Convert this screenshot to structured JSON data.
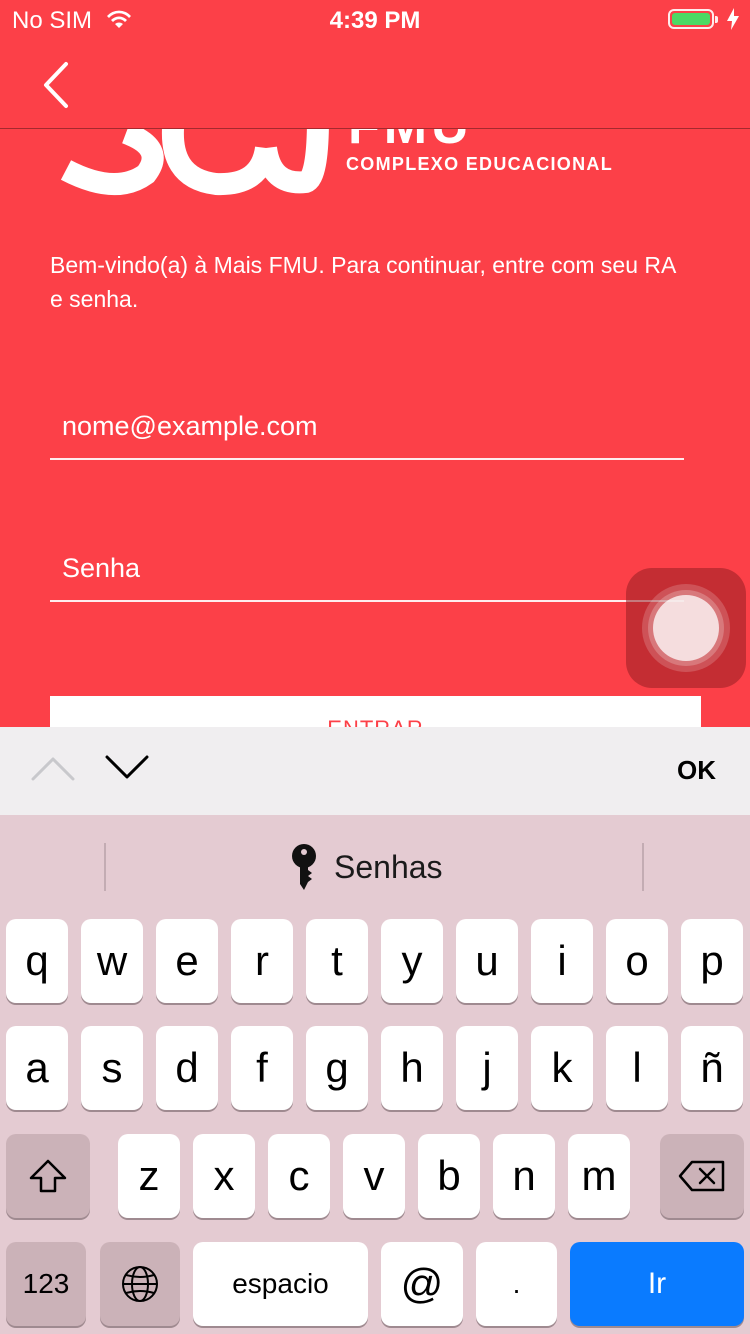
{
  "status_bar": {
    "carrier": "No SIM",
    "time": "4:39 PM"
  },
  "logo": {
    "brand": "FMU",
    "subtitle": "COMPLEXO EDUCACIONAL"
  },
  "welcome_text": "Bem-vindo(a) à Mais FMU. Para continuar, entre com seu RA e senha.",
  "form": {
    "email_placeholder": "nome@example.com",
    "password_placeholder": "Senha",
    "submit_label": "ENTRAR"
  },
  "accessory": {
    "done_label": "OK"
  },
  "keyboard": {
    "suggestion": "Senhas",
    "row1": [
      "q",
      "w",
      "e",
      "r",
      "t",
      "y",
      "u",
      "i",
      "o",
      "p"
    ],
    "row2": [
      "a",
      "s",
      "d",
      "f",
      "g",
      "h",
      "j",
      "k",
      "l",
      "ñ"
    ],
    "row3": [
      "z",
      "x",
      "c",
      "v",
      "b",
      "n",
      "m"
    ],
    "numbers_label": "123",
    "space_label": "espacio",
    "at_label": "@",
    "dot_label": ".",
    "go_label": "Ir"
  },
  "colors": {
    "brand_red": "#FC4048",
    "keyboard_bg": "#E4CBD2",
    "go_blue": "#0A7BFF"
  }
}
